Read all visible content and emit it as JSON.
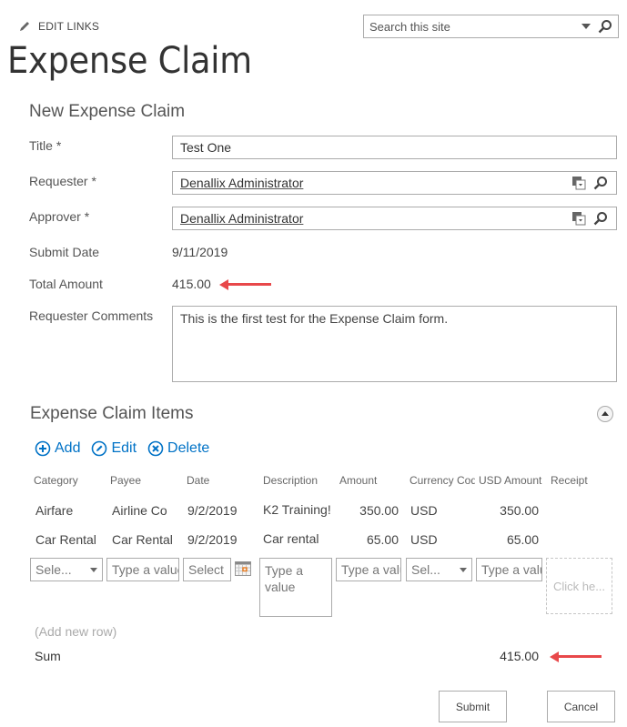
{
  "header": {
    "edit_links": "EDIT LINKS",
    "site_title": "Expense Claim",
    "search": {
      "placeholder": "Search this site",
      "value": ""
    }
  },
  "form": {
    "title": "New Expense Claim",
    "fields": {
      "title": {
        "label": "Title *",
        "value": "Test One"
      },
      "requester": {
        "label": "Requester *",
        "value": "Denallix Administrator"
      },
      "approver": {
        "label": "Approver *",
        "value": "Denallix Administrator"
      },
      "submit_date": {
        "label": "Submit Date",
        "value": "9/11/2019"
      },
      "total_amount": {
        "label": "Total Amount",
        "value": "415.00"
      },
      "comments": {
        "label": "Requester Comments",
        "value": "This is the first test for the Expense Claim form."
      }
    }
  },
  "items": {
    "title": "Expense Claim Items",
    "toolbar": {
      "add": "Add",
      "edit": "Edit",
      "delete": "Delete"
    },
    "columns": [
      "Category",
      "Payee",
      "Date",
      "Description",
      "Amount",
      "Currency Code",
      "USD Amount",
      "Receipt"
    ],
    "rows": [
      {
        "category": "Airfare",
        "payee": "Airline Co",
        "date": "9/2/2019",
        "description": "K2 Training!",
        "amount": "350.00",
        "currency": "USD",
        "usd_amount": "350.00",
        "receipt": ""
      },
      {
        "category": "Car Rental",
        "payee": "Car Rental",
        "date": "9/2/2019",
        "description": "Car rental",
        "amount": "65.00",
        "currency": "USD",
        "usd_amount": "65.00",
        "receipt": ""
      }
    ],
    "new_row": {
      "category": "Sele...",
      "payee": "Type a value",
      "date": "Select",
      "description": "Type a value",
      "amount": "Type a value",
      "currency": "Sel...",
      "usd_amount": "Type a value",
      "receipt": "Click he..."
    },
    "add_new_row": "(Add new row)",
    "sum_label": "Sum",
    "sum_value": "415.00"
  },
  "buttons": {
    "submit": "Submit",
    "cancel": "Cancel"
  },
  "colors": {
    "accent": "#0072c6",
    "annotation_arrow": "#e8484a"
  }
}
